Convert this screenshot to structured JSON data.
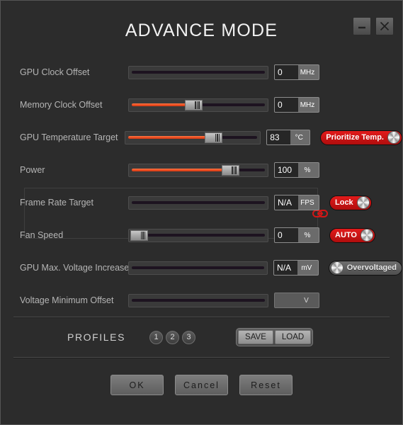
{
  "window": {
    "title": "ADVANCE MODE",
    "minimize_icon": "minimize-icon",
    "close_icon": "close-icon"
  },
  "rows": [
    {
      "label": "GPU Clock Offset",
      "value": "0",
      "unit": "MHz",
      "fill_percent": 0,
      "thumb_percent": -100,
      "disabled_box": false,
      "toggle": null
    },
    {
      "label": "Memory Clock Offset",
      "value": "0",
      "unit": "MHz",
      "fill_percent": 46,
      "thumb_percent": 46,
      "disabled_box": false,
      "toggle": null
    },
    {
      "label": "GPU Temperature Target",
      "value": "83",
      "unit": "°C",
      "fill_percent": 66,
      "thumb_percent": 66,
      "disabled_box": false,
      "toggle": {
        "label": "Prioritize Temp.",
        "state": "on",
        "knob_side": "right"
      }
    },
    {
      "label": "Power",
      "value": "100",
      "unit": "%",
      "fill_percent": 77,
      "thumb_percent": 77,
      "disabled_box": false,
      "toggle": null
    },
    {
      "label": "Frame Rate Target",
      "value": "N/A",
      "unit": "FPS",
      "fill_percent": 0,
      "thumb_percent": -100,
      "disabled_box": false,
      "toggle": {
        "label": "Lock",
        "state": "on",
        "knob_side": "right"
      }
    },
    {
      "label": "Fan Speed",
      "value": "0",
      "unit": "%",
      "fill_percent": 0,
      "thumb_percent": 0,
      "disabled_box": false,
      "toggle": {
        "label": "AUTO",
        "state": "on",
        "knob_side": "right"
      }
    },
    {
      "label": "GPU Max. Voltage Increase",
      "value": "N/A",
      "unit": "mV",
      "fill_percent": 0,
      "thumb_percent": -100,
      "disabled_box": false,
      "toggle": {
        "label": "Overvoltaged",
        "state": "off",
        "knob_side": "left"
      }
    },
    {
      "label": "Voltage Minimum Offset",
      "value": "",
      "unit": "V",
      "fill_percent": 0,
      "thumb_percent": -100,
      "disabled_box": true,
      "toggle": null
    }
  ],
  "link_icon": "chain-link-icon",
  "profiles": {
    "title": "PROFILES",
    "slots": [
      "1",
      "2",
      "3"
    ],
    "save_label": "SAVE",
    "load_label": "LOAD"
  },
  "footer": {
    "ok_label": "OK",
    "cancel_label": "Cancel",
    "reset_label": "Reset"
  },
  "colors": {
    "accent_red": "#cc1111",
    "slider_fill": "#e8471e",
    "window_bg": "#2c2c2c"
  }
}
